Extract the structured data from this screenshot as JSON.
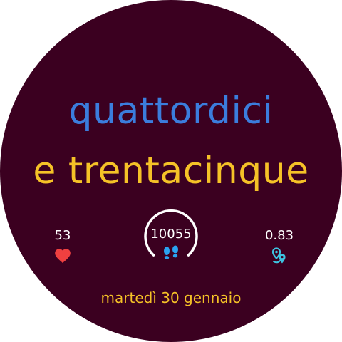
{
  "time": {
    "hours_text": "quattordici",
    "minutes_text": "e trentacinque"
  },
  "complications": {
    "heart_rate": {
      "value": "53",
      "icon": "heart-icon"
    },
    "steps": {
      "value": "10055",
      "icon": "footsteps-icon"
    },
    "distance": {
      "value": "0.83",
      "icon": "map-pin-icon"
    }
  },
  "date": {
    "text": "martedì 30 gennaio"
  },
  "colors": {
    "background": "#3b0020",
    "hours": "#3b7ddd",
    "minutes": "#f5c227",
    "heart": "#f04040",
    "steps_icon": "#2aa3f0",
    "distance_icon": "#3dc3e0",
    "ring": "#ffffff"
  }
}
